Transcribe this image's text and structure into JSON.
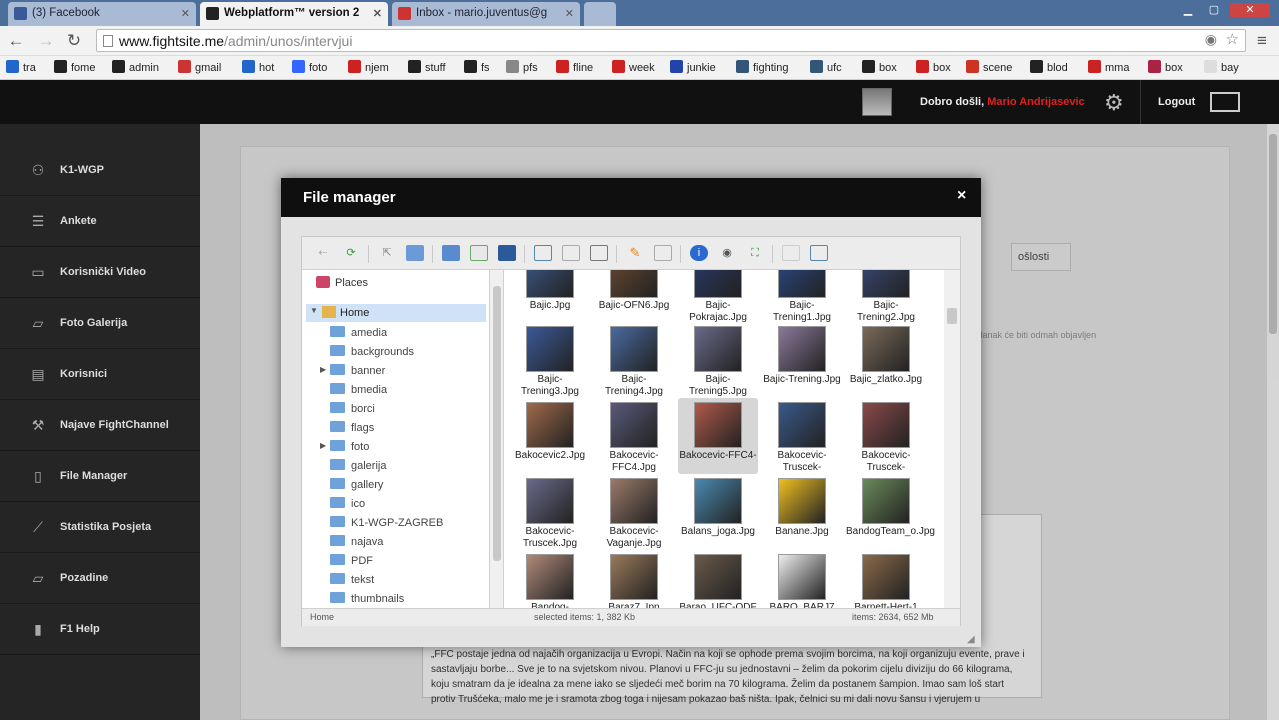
{
  "browser": {
    "tabs": [
      {
        "label": "(3) Facebook",
        "icon_color": "#3b5998",
        "active": false
      },
      {
        "label": "Webplatform™ version 2",
        "icon_color": "#222222",
        "active": true
      },
      {
        "label": "Inbox - mario.juventus@g",
        "icon_color": "#cc3333",
        "active": false
      },
      {
        "label": "",
        "icon_color": "#aaaaaa",
        "active": false
      }
    ],
    "url_host": "www.fightsite.me",
    "url_path": "/admin/unos/intervjui",
    "bookmarks": [
      {
        "label": "tra",
        "color": "#2266cc"
      },
      {
        "label": "fome",
        "color": "#222222"
      },
      {
        "label": "admin",
        "color": "#222222"
      },
      {
        "label": "gmail",
        "color": "#cc3333"
      },
      {
        "label": "hot",
        "color": "#2266cc"
      },
      {
        "label": "foto",
        "color": "#3366ff"
      },
      {
        "label": "njem",
        "color": "#cc2222"
      },
      {
        "label": "stuff",
        "color": "#222222"
      },
      {
        "label": "fs",
        "color": "#222222"
      },
      {
        "label": "pfs",
        "color": "#888888"
      },
      {
        "label": "fline",
        "color": "#cc2222"
      },
      {
        "label": "week",
        "color": "#cc2222"
      },
      {
        "label": "junkie",
        "color": "#2244aa"
      },
      {
        "label": "fighting",
        "color": "#335577"
      },
      {
        "label": "ufc",
        "color": "#335577"
      },
      {
        "label": "box",
        "color": "#222222"
      },
      {
        "label": "box",
        "color": "#cc2222"
      },
      {
        "label": "scene",
        "color": "#cc3322"
      },
      {
        "label": "blod",
        "color": "#222222"
      },
      {
        "label": "mma",
        "color": "#cc2222"
      },
      {
        "label": "box",
        "color": "#aa2244"
      },
      {
        "label": "bay",
        "color": "#dddddd"
      }
    ]
  },
  "header": {
    "welcome": "Dobro došli,",
    "username": "Mario Andrijasevic",
    "logout": "Logout"
  },
  "sidebar": {
    "items": [
      {
        "label": "K1-WGP",
        "icon": "users-icon"
      },
      {
        "label": "Ankete",
        "icon": "list-icon"
      },
      {
        "label": "Korisnički Video",
        "icon": "video-icon"
      },
      {
        "label": "Foto Galerija",
        "icon": "folder-icon"
      },
      {
        "label": "Korisnici",
        "icon": "grid-icon"
      },
      {
        "label": "Najave FightChannel",
        "icon": "wrench-icon"
      },
      {
        "label": "File Manager",
        "icon": "file-icon"
      },
      {
        "label": "Statistika Posjeta",
        "icon": "chart-icon"
      },
      {
        "label": "Pozadine",
        "icon": "folder-icon"
      },
      {
        "label": "F1 Help",
        "icon": "book-icon"
      }
    ]
  },
  "background": {
    "button_label": "ošlosti",
    "hint": ", članak će biti odmah objavljen",
    "article_text": "„FFC postaje jedna od najačih organizacija u Evropi. Način na koji se ophode prema svojim borcima, na koji organizuju evente, prave i sastavljaju borbe... Sve je to na svjetskom nivou. Planovi u FFC-ju su jednostavni – želim da pokorim cijelu diviziju do 66 kilograma, koju smatram da je idealna za mene iako se sljedeći meč borim na 70 kilograma. Želim da postanem šampion. Imao sam loš start protiv Trušćeka, malo me je i sramota zbog toga i nijesam pokazao baš ništa. Ipak, čelnici su mi dali novu šansu i vjerujem u"
  },
  "file_manager": {
    "title": "File manager",
    "close": "×",
    "places": "Places",
    "home": "Home",
    "folders": [
      {
        "name": "amedia",
        "expandable": false
      },
      {
        "name": "backgrounds",
        "expandable": false
      },
      {
        "name": "banner",
        "expandable": true
      },
      {
        "name": "bmedia",
        "expandable": false
      },
      {
        "name": "borci",
        "expandable": false
      },
      {
        "name": "flags",
        "expandable": false
      },
      {
        "name": "foto",
        "expandable": true
      },
      {
        "name": "galerija",
        "expandable": false
      },
      {
        "name": "gallery",
        "expandable": false
      },
      {
        "name": "ico",
        "expandable": false
      },
      {
        "name": "K1-WGP-ZAGREB",
        "expandable": false
      },
      {
        "name": "najava",
        "expandable": false
      },
      {
        "name": "PDF",
        "expandable": false
      },
      {
        "name": "tekst",
        "expandable": false
      },
      {
        "name": "thumbnails",
        "expandable": false
      }
    ],
    "files": [
      {
        "name": "Bajic.Jpg",
        "color": "#3c5a8a"
      },
      {
        "name": "Bajic-OFN6.Jpg",
        "color": "#6a4a32"
      },
      {
        "name": "Bajic-Pokrajac.Jpg",
        "color": "#2a3a6a"
      },
      {
        "name": "Bajic-Trening1.Jpg",
        "color": "#2a4a8a"
      },
      {
        "name": "Bajic-Trening2.Jpg",
        "color": "#3a4a7a"
      },
      {
        "name": "Bajic-Trening3.Jpg",
        "color": "#3a5a9a"
      },
      {
        "name": "Bajic-Trening4.Jpg",
        "color": "#4a6aa0"
      },
      {
        "name": "Bajic-Trening5.Jpg",
        "color": "#6a6a8a"
      },
      {
        "name": "Bajic-Trening.Jpg",
        "color": "#8a7a9a"
      },
      {
        "name": "Bajic_zlatko.Jpg",
        "color": "#7a6a5a"
      },
      {
        "name": "Bakocevic2.Jpg",
        "color": "#a06a4a"
      },
      {
        "name": "Bakocevic-FFC4.Jpg",
        "color": "#5a5a7a"
      },
      {
        "name": "Bakocevic-FFC4-",
        "color": "#b05a4a"
      },
      {
        "name": "Bakocevic-Truscek-",
        "color": "#3a5a8a"
      },
      {
        "name": "Bakocevic-Truscek-",
        "color": "#8a4a4a"
      },
      {
        "name": "Bakocevic-Truscek.Jpg",
        "color": "#6a6a8a"
      },
      {
        "name": "Bakocevic-Vaganje.Jpg",
        "color": "#9a7a6a"
      },
      {
        "name": "Balans_joga.Jpg",
        "color": "#4a8ab0"
      },
      {
        "name": "Banane.Jpg",
        "color": "#f0c020"
      },
      {
        "name": "BandogTeam_o.Jpg",
        "color": "#6a8a5a"
      },
      {
        "name": "Bandog-",
        "color": "#b08a7a"
      },
      {
        "name": "Baraz7_Ipn",
        "color": "#9a7a5a"
      },
      {
        "name": "Barao_UFC-ODF",
        "color": "#6a5a4a"
      },
      {
        "name": "BARO_BARJ7",
        "color": "#eeeeee"
      },
      {
        "name": "Barnett-Hert-1",
        "color": "#8a6a4a"
      }
    ],
    "status_path": "Home",
    "status_selected": "selected items: 1, 382 Kb",
    "status_total": "items: 2634, 652 Mb"
  }
}
